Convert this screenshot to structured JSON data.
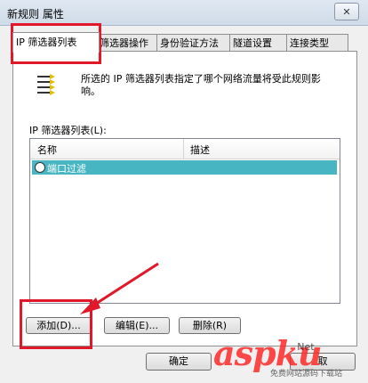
{
  "window": {
    "title": "新规则 属性",
    "close_glyph": "✕"
  },
  "tabs": [
    {
      "label": "IP 筛选器列表",
      "active": true
    },
    {
      "label": "筛选器操作",
      "active": false
    },
    {
      "label": "身份验证方法",
      "active": false
    },
    {
      "label": "隧道设置",
      "active": false
    },
    {
      "label": "连接类型",
      "active": false
    }
  ],
  "description": "所选的 IP 筛选器列表指定了哪个网络流量将受此规则影响。",
  "list": {
    "label": "IP 筛选器列表(L):",
    "columns": [
      "名称",
      "描述"
    ],
    "rows": [
      {
        "name": "端口过滤",
        "description": "",
        "selected": true
      }
    ]
  },
  "buttons": {
    "add": "添加(D)...",
    "edit": "编辑(E)...",
    "delete": "删除(R)",
    "ok": "确定",
    "partial": "取"
  },
  "watermark": {
    "text": "aspku",
    "sub": "Net",
    "bottom": "免费网站源码下载站"
  },
  "colors": {
    "selection": "#47b5c2",
    "annotation": "#e0182a",
    "watermark": "#ff2a2a"
  }
}
